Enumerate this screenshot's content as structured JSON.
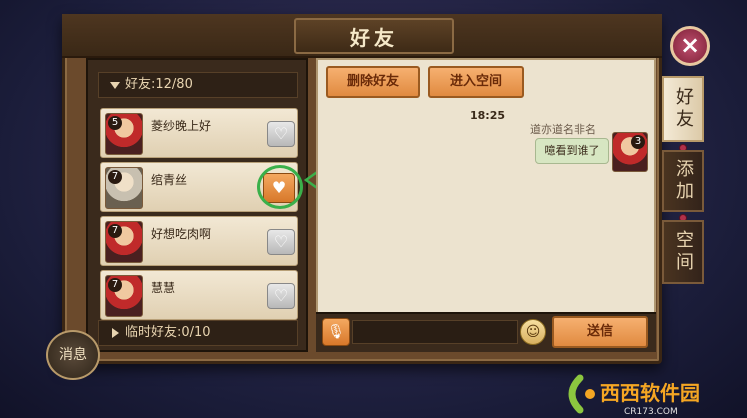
{
  "window": {
    "title": "好友",
    "close_icon": "close-icon"
  },
  "friends": {
    "header": "好友:12/80",
    "list": [
      {
        "name": "菱纱晚上好",
        "level": "5",
        "heart_active": false
      },
      {
        "name": "绾青丝",
        "level": "7",
        "heart_active": true
      },
      {
        "name": "好想吃肉啊",
        "level": "7",
        "heart_active": false
      },
      {
        "name": "慧慧",
        "level": "7",
        "heart_active": false
      }
    ],
    "temp_header": "临时好友:0/10"
  },
  "messages_button": "消息",
  "chat": {
    "delete_button": "删除好友",
    "visit_button": "进入空间",
    "timestamp": "18:25",
    "sender": "道亦道名非名",
    "message": "噫看到谁了",
    "sender_level": "3",
    "send_button": "送信"
  },
  "tabs": [
    "好友",
    "添加",
    "空间"
  ],
  "watermark": {
    "brand": "西西软件园",
    "url": "CR173.COM"
  },
  "colors": {
    "accent_orange": "#e08a40",
    "highlight_green": "#3ab04a",
    "tab_active_bg": "#f4ead6"
  }
}
